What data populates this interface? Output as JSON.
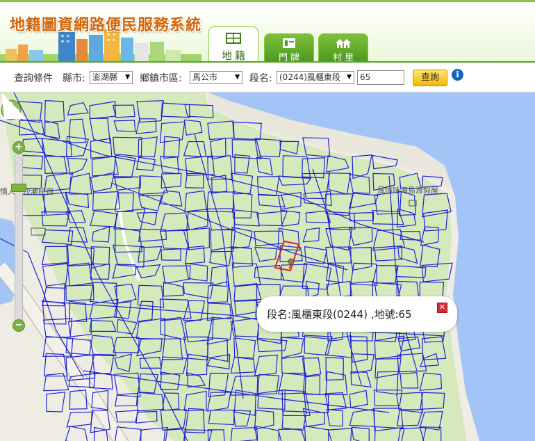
{
  "header": {
    "title": "地籍圖資網路便民服務系統",
    "tabs": [
      {
        "label": "地籍",
        "icon": "parcel-map-icon",
        "active": true
      },
      {
        "label": "門牌",
        "icon": "doorplate-icon",
        "active": false
      },
      {
        "label": "村里",
        "icon": "village-houses-icon",
        "active": false
      }
    ]
  },
  "query": {
    "label": "查詢條件",
    "county_label": "縣市:",
    "county_value": "澎湖縣",
    "township_label": "鄉鎮市區:",
    "township_value": "馬公市",
    "section_label": "段名:",
    "section_value": "(0244)風櫃東段",
    "lot_value": "65",
    "submit_label": "查詢",
    "info_icon": "i"
  },
  "map": {
    "labels": {
      "left_place": "情人橋沙灘民宿",
      "right_place": "風情味海島渡假屋"
    },
    "popup": {
      "text": "段名:風櫃東段(0244) ,地號:65",
      "close_icon": "close-icon"
    },
    "colors": {
      "land": "#d6e9bd",
      "sea": "#a3c4f6",
      "parcel_line": "#1c22d6",
      "highlight": "#e02020",
      "road": "#f3f1ea"
    }
  }
}
